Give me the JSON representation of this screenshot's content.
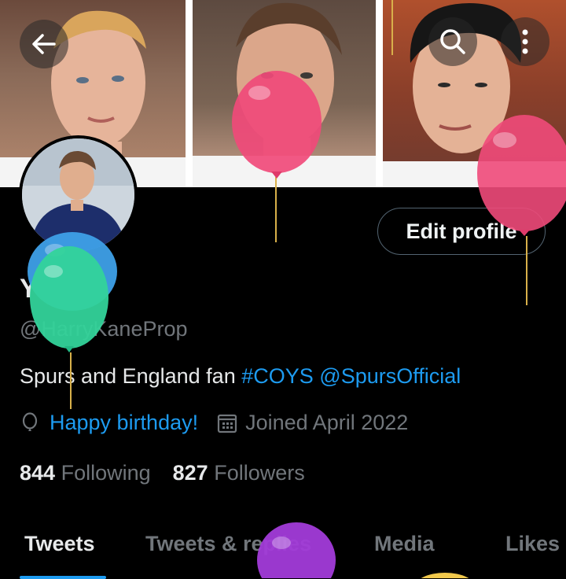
{
  "header": {
    "back_icon": "arrow-left-icon",
    "search_icon": "search-icon",
    "more_icon": "more-vertical-icon"
  },
  "profile": {
    "display_name": "Y",
    "handle": "@HarryKaneProp",
    "bio_text": "Spurs and England fan ",
    "bio_hashtag": "#COYS",
    "bio_mention": "@SpursOfficial",
    "birthday_label": "Happy birthday!",
    "joined_label": "Joined April 2022",
    "following_count": "844",
    "following_label": "Following",
    "followers_count": "827",
    "followers_label": "Followers"
  },
  "actions": {
    "edit_profile_label": "Edit profile"
  },
  "tabs": [
    {
      "label": "Tweets",
      "active": true
    },
    {
      "label": "Tweets & replies",
      "active": false
    },
    {
      "label": "Media",
      "active": false
    },
    {
      "label": "Likes",
      "active": false
    }
  ],
  "colors": {
    "accent": "#1d9bf0",
    "background": "#000000",
    "text_primary": "#e7e9ea",
    "text_secondary": "#71767b",
    "balloon_pink": "#f04a7a",
    "balloon_blue": "#3ea0e8",
    "balloon_green": "#33d39a",
    "balloon_purple": "#a23bd9",
    "balloon_yellow": "#f2c94c"
  }
}
